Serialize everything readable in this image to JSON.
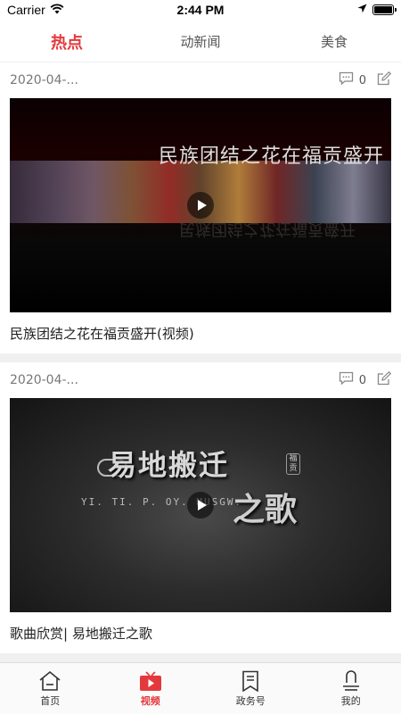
{
  "status_bar": {
    "carrier": "Carrier",
    "time": "2:44 PM"
  },
  "top_tabs": [
    {
      "label": "热点",
      "active": true
    },
    {
      "label": "动新闻",
      "active": false
    },
    {
      "label": "美食",
      "active": false
    }
  ],
  "feed": [
    {
      "date": "2020-04-...",
      "comment_count": "0",
      "title": "民族团结之花在福贡盛开(视频)",
      "thumb_caption": "民族团结之花在福贡盛开",
      "thumb_reflection": "民族团结之花在福贡盛开"
    },
    {
      "date": "2020-04-...",
      "comment_count": "0",
      "title": "歌曲欣赏| 易地搬迁之歌",
      "thumb_caption": "易地搬迁",
      "thumb_caption_2": "之歌",
      "thumb_sub": "YI. TI. P. OY. MUSGW:",
      "thumb_seal": "福贡"
    }
  ],
  "bottom_nav": [
    {
      "label": "首页",
      "icon": "home-icon",
      "active": false
    },
    {
      "label": "视频",
      "icon": "tv-video-icon",
      "active": true
    },
    {
      "label": "政务号",
      "icon": "bookmark-icon",
      "active": false
    },
    {
      "label": "我的",
      "icon": "profile-icon",
      "active": false
    }
  ],
  "colors": {
    "accent": "#e4393c"
  }
}
